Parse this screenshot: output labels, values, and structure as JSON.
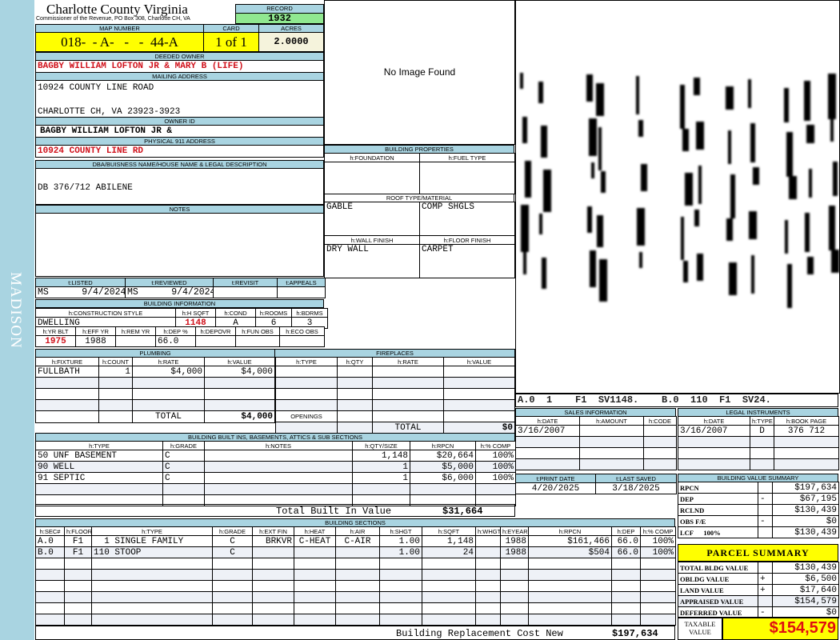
{
  "sidebar": {
    "label": "MADISON"
  },
  "header": {
    "title": "Charlotte County Virginia",
    "subtitle": "Commissioner of the Revenue, PO Box 308, Charlotte CH, VA",
    "record_label": "RECORD",
    "record": "1932"
  },
  "parcel": {
    "map_label": "MAP NUMBER",
    "map_number": "018-  - A-   -   -  44-A",
    "card_label": "CARD",
    "card": "1 of 1",
    "acres_label": "ACRES",
    "acres": "2.0000"
  },
  "owner": {
    "deeded_label": "DEEDED OWNER",
    "deeded": "BAGBY WILLIAM LOFTON JR & MARY B (LIFE)",
    "mailing_label": "MAILING ADDRESS",
    "mail1": "10924 COUNTY LINE ROAD",
    "mail2": "CHARLOTTE CH, VA 23923-3923",
    "id_label": "OWNER ID",
    "id": "BAGBY WILLIAM LOFTON JR &",
    "phys_label": "PHYSICAL 911 ADDRESS",
    "phys": "10924 COUNTY LINE RD"
  },
  "legal": {
    "label": "DBA/BUISNESS NAME/HOUSE NAME & LEGAL DESCRIPTION",
    "text": "DB 376/712 ABILENE",
    "notes_label": "NOTES"
  },
  "image": {
    "text": "No Image Found"
  },
  "sketch": {
    "text": "A.0  1    F1  SV1148.    B.0  110  F1  SV24."
  },
  "tables": {
    "listed": [
      [
        "t:LISTED",
        "t:REVIEWED",
        "t:REVISIT",
        "t:APPEALS"
      ],
      [
        "MS      9/4/2024",
        "MS      9/4/2024",
        "",
        ""
      ]
    ],
    "bldg1": [
      [
        "h:CONSTRUCTION STYLE",
        "h:H SQFT",
        "h:COND",
        "h:ROOMS",
        "h:BDRMS"
      ],
      [
        "DWELLING",
        "1148",
        "A",
        "6",
        "3"
      ]
    ],
    "bldg2": [
      [
        "h:YR BLT",
        "h:EFF YR",
        "h:REM YR",
        "h:DEP %",
        "h:DEPOVR",
        "h:FUN OBS",
        "h:ECO OBS"
      ],
      [
        "1975",
        "1988",
        "",
        "66.0",
        "",
        "",
        ""
      ]
    ],
    "plumbing": [
      [
        "h:FIXTURE",
        "h:COUNT",
        "h:RATE",
        "h:VALUE"
      ],
      [
        "FULLBATH",
        "1",
        "$4,000",
        "$4,000"
      ],
      [
        "",
        "",
        "",
        ""
      ],
      [
        "",
        "",
        "",
        ""
      ],
      [
        "",
        "",
        "",
        ""
      ],
      [
        "",
        "",
        "TOTAL",
        "$4,000"
      ]
    ],
    "fireplaces": [
      [
        "h:TYPE",
        "h:QTY",
        "h:RATE",
        "h:VALUE"
      ],
      [
        "",
        "",
        "",
        ""
      ],
      [
        "",
        "",
        "",
        ""
      ],
      [
        "",
        "",
        "",
        ""
      ],
      [
        "",
        "",
        "",
        ""
      ],
      [
        "OPENINGS",
        "",
        "",
        ""
      ],
      [
        "",
        "",
        "TOTAL",
        "$0"
      ]
    ],
    "props1": [
      [
        "h:FOUNDATION",
        "h:FUEL TYPE"
      ],
      [
        "",
        ""
      ]
    ],
    "props2": [
      [
        "GABLE",
        "COMP SHGLS"
      ]
    ],
    "props3": [
      [
        "h:WALL FINISH",
        "h:FLOOR FINISH"
      ],
      [
        "DRY WALL",
        "CARPET"
      ]
    ],
    "builtins": [
      [
        "h:TYPE",
        "h:GRADE",
        "h:NOTES",
        "h:QTY/SIZE",
        "h:RPCN",
        "h:% COMP"
      ],
      [
        "50 UNF BASEMENT",
        "C",
        "",
        "1,148",
        "$20,664",
        "100%"
      ],
      [
        "90 WELL",
        "C",
        "",
        "1",
        "$5,000",
        "100%"
      ],
      [
        "91 SEPTIC",
        "C",
        "",
        "1",
        "$6,000",
        "100%"
      ],
      [
        "",
        "",
        "",
        "",
        "",
        ""
      ],
      [
        "",
        "",
        "",
        "",
        "",
        ""
      ]
    ],
    "sections": [
      [
        "h:SEC#",
        "h:FLOOR",
        "h:TYPE",
        "h:GRADE",
        "h:EXT FIN",
        "h:HEAT",
        "h:AIR",
        "h:SHGT",
        "h:SQFT",
        "h:WHGT",
        "h:EYEAR",
        "h:RPCN",
        "h:DEP",
        "h:% COMP"
      ],
      [
        "A.0",
        "F1",
        "  1 SINGLE FAMILY",
        "C",
        "BRKVR",
        "C-HEAT",
        "C-AIR",
        "1.00",
        "1,148",
        "",
        "1988",
        "$161,466",
        "66.0",
        "100%"
      ],
      [
        "B.0",
        "F1",
        "110 STOOP",
        "C",
        "",
        "",
        "",
        "1.00",
        "24",
        "",
        "1988",
        "$504",
        "66.0",
        "100%"
      ],
      [
        "",
        "",
        "",
        "",
        "",
        "",
        "",
        "",
        "",
        "",
        "",
        "",
        "",
        ""
      ],
      [
        "",
        "",
        "",
        "",
        "",
        "",
        "",
        "",
        "",
        "",
        "",
        "",
        "",
        ""
      ],
      [
        "",
        "",
        "",
        "",
        "",
        "",
        "",
        "",
        "",
        "",
        "",
        "",
        "",
        ""
      ],
      [
        "",
        "",
        "",
        "",
        "",
        "",
        "",
        "",
        "",
        "",
        "",
        "",
        "",
        ""
      ],
      [
        "",
        "",
        "",
        "",
        "",
        "",
        "",
        "",
        "",
        "",
        "",
        "",
        "",
        ""
      ],
      [
        "",
        "",
        "",
        "",
        "",
        "",
        "",
        "",
        "",
        "",
        "",
        "",
        "",
        ""
      ]
    ],
    "sales": [
      [
        "h:DATE",
        "h:AMOUNT",
        "h:CODE"
      ],
      [
        "3/16/2007",
        "",
        ""
      ],
      [
        "",
        "",
        ""
      ],
      [
        "",
        "",
        ""
      ],
      [
        "",
        "",
        ""
      ]
    ],
    "legalinst": [
      [
        "h:DATE",
        "h:TYPE",
        "h:BOOK PAGE"
      ],
      [
        "3/16/2007",
        "D",
        "376 712"
      ],
      [
        "",
        "",
        ""
      ],
      [
        "",
        "",
        ""
      ],
      [
        "",
        "",
        ""
      ]
    ],
    "dates": [
      [
        "t:PRINT DATE",
        "t:LAST SAVED"
      ],
      [
        "4/20/2025",
        "3/18/2025"
      ]
    ],
    "bvs": [
      [
        "RPCN",
        "",
        "$197,634"
      ],
      [
        "DEP",
        "-",
        "$67,195"
      ],
      [
        "RCLND",
        "",
        "$130,439"
      ],
      [
        "OBS F/E",
        "-",
        "$0"
      ],
      [
        "LCF      100%",
        "",
        "$130,439"
      ]
    ],
    "parcel_summary": [
      [
        "TOTAL BLDG VALUE",
        "",
        "$130,439"
      ],
      [
        "OBLDG VALUE",
        "+",
        "$6,500"
      ],
      [
        "LAND VALUE",
        "+",
        "$17,640"
      ],
      [
        "APPRAISED VALUE",
        "",
        "$154,579"
      ],
      [
        "DEFERRED VALUE",
        "-",
        "$0"
      ]
    ]
  },
  "titles": {
    "building_properties": "BUILDING PROPERTIES",
    "roof": "ROOF TYPE/MATERIAL",
    "building_info": "BUILDING INFORMATION",
    "plumbing": "PLUMBING",
    "fireplaces": "FIREPLACES",
    "builtins": "BUILDING BUILT INS, BASEMENTS, ATTICS & SUB SECTIONS",
    "sections": "BUILDING SECTIONS",
    "sales": "SALES INFORMATION",
    "legal": "LEGAL INSTRUMENTS",
    "bvs": "BUILDING VALUE SUMMARY",
    "parcel_summary": "PARCEL SUMMARY"
  },
  "totals": {
    "builtin_label": "Total Built In Value",
    "builtin": "$31,664",
    "rcn_label": "Building Replacement Cost New",
    "rcn": "$197,634",
    "taxable_label": "TAXABLE VALUE",
    "taxable": "$154,579"
  },
  "colors": {
    "header": "#a9d4e1",
    "record": "#90e890",
    "highlight": "#ffff00",
    "value_red": "#d0101a"
  }
}
